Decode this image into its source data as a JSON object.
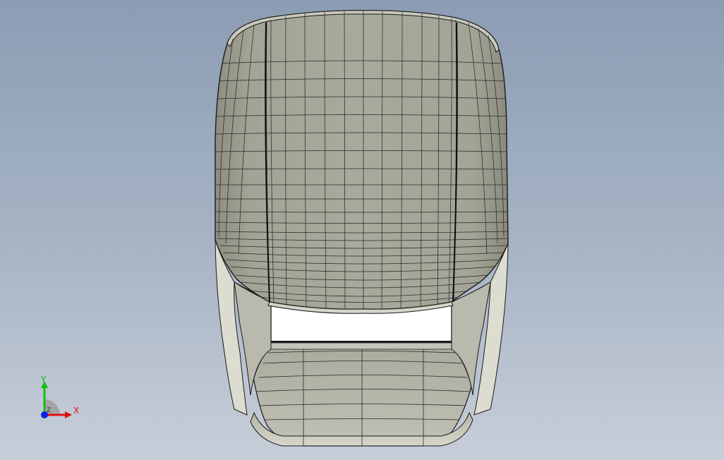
{
  "viewport": {
    "background_top": "#8c9cb3",
    "background_bottom": "#c7ced8"
  },
  "model": {
    "shell_color": "#a8a89a",
    "shell_light": "#c9c9bd",
    "flange_color": "#dcdcd0",
    "edge_color": "#1a1a1a",
    "opening_color": "#ffffff"
  },
  "triad": {
    "x_label": "X",
    "y_label": "Y",
    "z_label": "Z",
    "x_color": "#e01010",
    "y_color": "#10c010",
    "z_color": "#1020e0"
  }
}
